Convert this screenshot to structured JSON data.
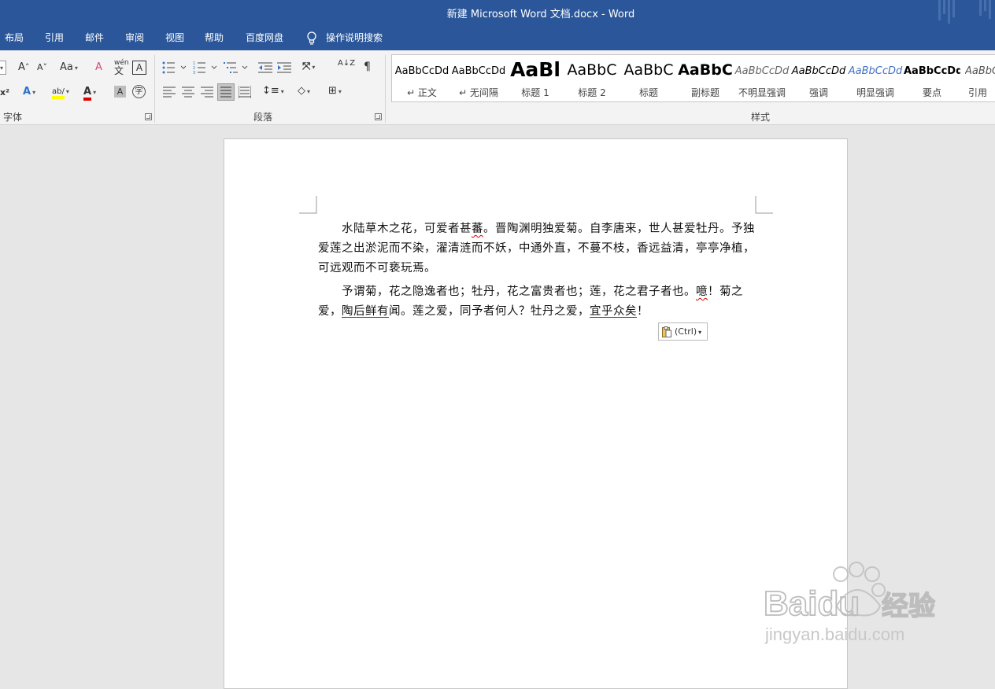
{
  "window": {
    "title": "新建 Microsoft Word 文档.docx  -  Word"
  },
  "tabs": [
    "布局",
    "引用",
    "邮件",
    "审阅",
    "视图",
    "帮助",
    "百度网盘",
    "操作说明搜索"
  ],
  "ribbon": {
    "font_group": {
      "label": "字体",
      "grow_font": "A",
      "shrink_font": "A",
      "change_case": "Aa",
      "clear_format_glyph": "A",
      "phonetic_guide": "wén",
      "phonetic_char": "文",
      "char_border": "A",
      "superscript": "x²",
      "text_effects": "A",
      "highlight": "ab/",
      "font_color": "A",
      "char_shading": "A",
      "enclose_char": "字"
    },
    "paragraph_group": {
      "label": "段落",
      "sort": "A↓Z",
      "show_marks": "¶"
    },
    "styles_group": {
      "label": "样式",
      "items": [
        {
          "preview": "AaBbCcDd",
          "name": "↵ 正文"
        },
        {
          "preview": "AaBbCcDd",
          "name": "↵ 无间隔"
        },
        {
          "preview": "AaBl",
          "name": "标题 1"
        },
        {
          "preview": "AaBbC",
          "name": "标题 2"
        },
        {
          "preview": "AaBbC",
          "name": "标题"
        },
        {
          "preview": "AaBbC",
          "name": "副标题"
        },
        {
          "preview": "AaBbCcDd",
          "name": "不明显强调"
        },
        {
          "preview": "AaBbCcDd",
          "name": "强调"
        },
        {
          "preview": "AaBbCcDd",
          "name": "明显强调"
        },
        {
          "preview": "AaBbCcDd",
          "name": "要点"
        },
        {
          "preview": "AaBbC",
          "name": "引用"
        }
      ]
    }
  },
  "document": {
    "p1": {
      "a": "水陆草木之花，可爱者甚",
      "b": "蕃",
      "c": "。晋陶渊明独爱菊。自李唐来，世人甚爱牡丹。予独爱莲之出淤泥而不染，濯清涟而不妖，中通外直，不蔓不枝，香远益清，亭亭净植，可远观而不可亵玩焉。"
    },
    "p2": {
      "a": "予谓菊，花之隐逸者也；牡丹，花之富贵者也；莲，花之君子者也。",
      "b": "噫",
      "c": "！菊之爱，",
      "d": "陶后鲜有",
      "e": "闻。莲之爱，同予者何人？牡丹之爱，",
      "f": "宜乎众矣",
      "g": "！"
    },
    "paste_options": "(Ctrl)",
    "paste_arrow": "▾"
  },
  "watermark": {
    "brand": "Baidu",
    "cn": "经验",
    "url": "jingyan.baidu.com"
  },
  "colors": {
    "title_bar": "#2b579a",
    "ribbon": "#f3f3f3",
    "canvas": "#e6e6e6",
    "highlight": "#ffff00",
    "font_color": "#e00000"
  }
}
